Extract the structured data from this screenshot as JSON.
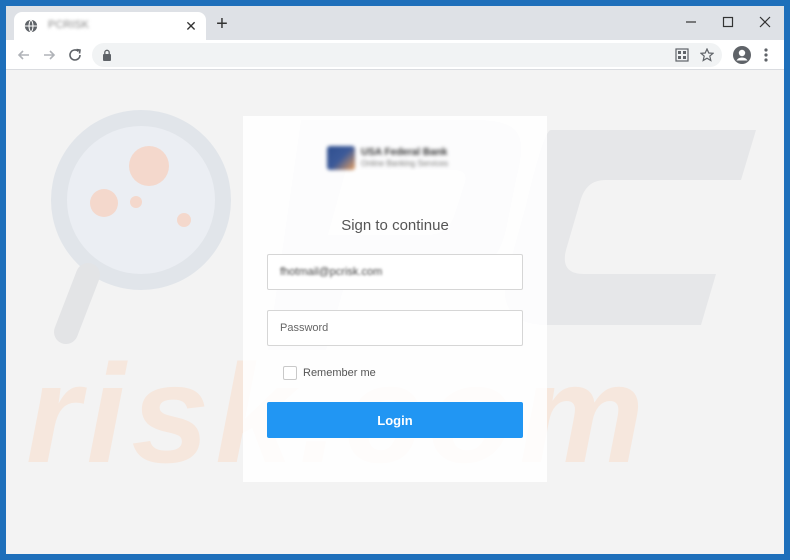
{
  "browser": {
    "tab_title": "PCRISK",
    "new_tab_label": "+",
    "tab_close_label": "✕",
    "favicon_icon": "globe-icon",
    "colors": {
      "frame": "#1e6fba",
      "tabstrip": "#dee1e6",
      "accent": "#2196f3"
    }
  },
  "login": {
    "logo_line1": "USA Federal Bank",
    "logo_line2": "Online Banking Services",
    "heading": "Sign to continue",
    "email_value": "fhotmail@pcrisk.com",
    "password_placeholder": "Password",
    "remember_label": "Remember me",
    "remember_checked": false,
    "login_label": "Login"
  },
  "watermark": {
    "text": "risk.com"
  }
}
